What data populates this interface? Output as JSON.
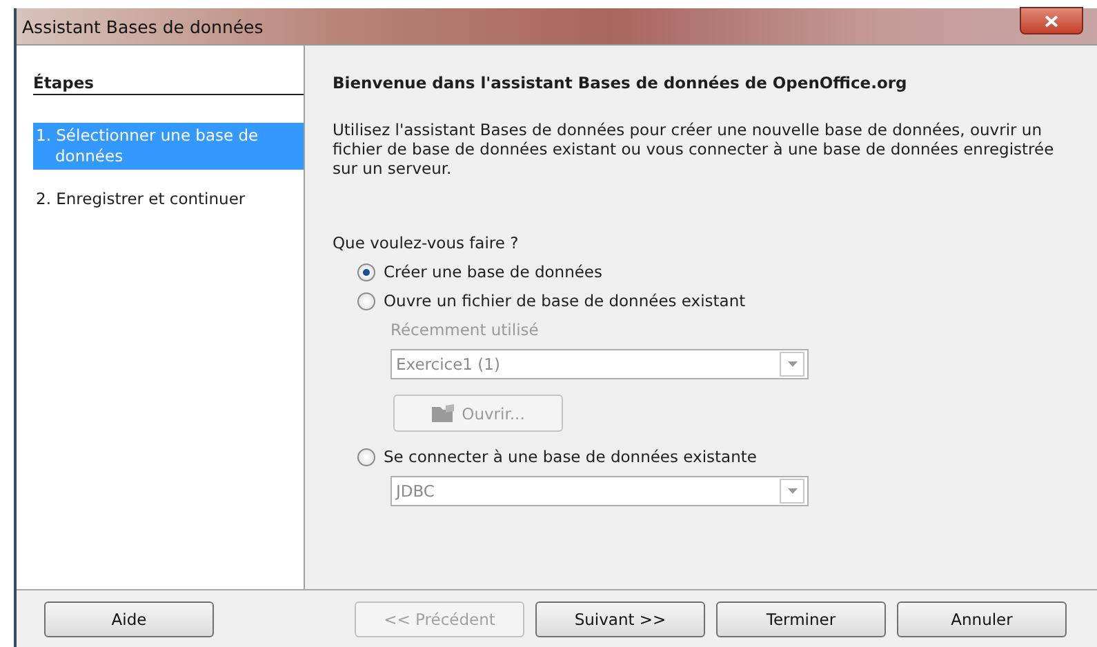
{
  "window": {
    "title": "Assistant Bases de données"
  },
  "steps": {
    "heading": "Étapes",
    "items": [
      {
        "label": "1. Sélectionner une base de données",
        "selected": true
      },
      {
        "label": "2. Enregistrer et continuer",
        "selected": false
      }
    ]
  },
  "content": {
    "title": "Bienvenue dans l'assistant Bases de données de OpenOffice.org",
    "intro": "Utilisez l'assistant Bases de données pour créer une nouvelle base de données, ouvrir un fichier de base de données existant ou vous connecter à une base de données enregistrée sur un serveur.",
    "question": "Que voulez-vous faire ?",
    "options": [
      {
        "kind": "radio",
        "label": "Créer une base de données",
        "selected": true
      },
      {
        "kind": "radio",
        "label": "Ouvre un fichier de base de données existant",
        "selected": false
      },
      {
        "kind": "field-label",
        "label": "Récemment utilisé",
        "disabled": true
      },
      {
        "kind": "dropdown",
        "value": "Exercice1 (1)",
        "disabled": true
      },
      {
        "kind": "button",
        "label": "Ouvrir...",
        "disabled": true
      },
      {
        "kind": "radio",
        "label": "Se connecter à une base de données existante",
        "selected": false
      },
      {
        "kind": "dropdown",
        "value": "JDBC",
        "disabled": true
      }
    ]
  },
  "buttons": [
    {
      "label": "Aide",
      "disabled": false
    },
    {
      "label": "<< Précédent",
      "disabled": true
    },
    {
      "label": "Suivant >>",
      "disabled": false
    },
    {
      "label": "Terminer",
      "disabled": false
    },
    {
      "label": "Annuler",
      "disabled": false
    }
  ]
}
